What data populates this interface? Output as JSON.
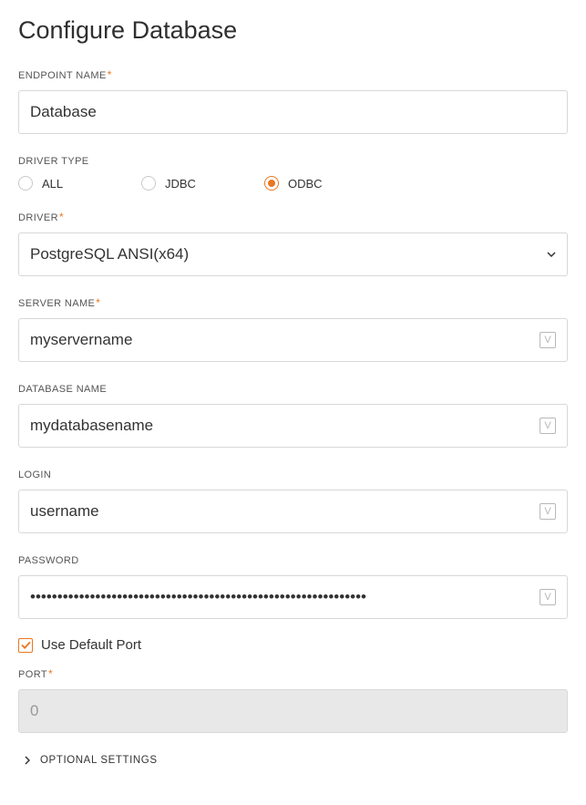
{
  "title": "Configure Database",
  "endpoint_name": {
    "label": "ENDPOINT NAME",
    "value": "Database"
  },
  "driver_type": {
    "label": "DRIVER TYPE",
    "options": [
      {
        "label": "ALL",
        "selected": false
      },
      {
        "label": "JDBC",
        "selected": false
      },
      {
        "label": "ODBC",
        "selected": true
      }
    ]
  },
  "driver": {
    "label": "DRIVER",
    "value": "PostgreSQL ANSI(x64)"
  },
  "server_name": {
    "label": "SERVER NAME",
    "value": "myservername"
  },
  "database_name": {
    "label": "DATABASE NAME",
    "value": "mydatabasename"
  },
  "login": {
    "label": "LOGIN",
    "value": "username"
  },
  "password": {
    "label": "PASSWORD",
    "value": "••••••••••••••••••••••••••••••••••••••••••••••••••••••••••••••"
  },
  "use_default_port": {
    "label": "Use Default Port",
    "checked": true
  },
  "port": {
    "label": "PORT",
    "value": "",
    "placeholder": "0",
    "disabled": true
  },
  "optional_settings": {
    "label": "OPTIONAL SETTINGS"
  },
  "var_icon_glyph": "V"
}
